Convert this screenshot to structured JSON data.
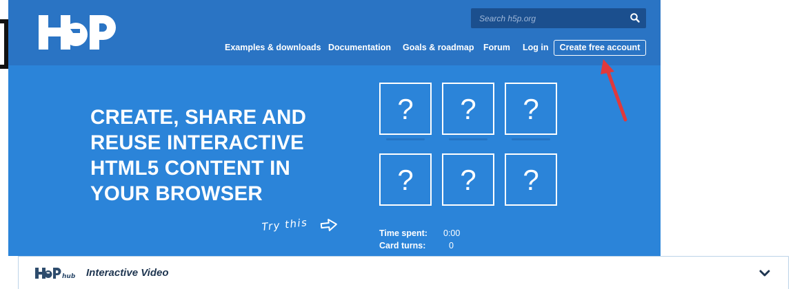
{
  "header": {
    "search_placeholder": "Search h5p.org",
    "nav": [
      "Examples & downloads",
      "Documentation",
      "Goals & roadmap",
      "Forum",
      "Log in"
    ],
    "cta_label": "Create free account"
  },
  "hero": {
    "headline_lines": [
      "CREATE, SHARE AND",
      "REUSE INTERACTIVE",
      "HTML5 CONTENT IN",
      "YOUR BROWSER"
    ],
    "try_label": "Try this",
    "cards": [
      "?",
      "?",
      "?",
      "?",
      "?",
      "?"
    ],
    "stats": {
      "time_label": "Time spent:",
      "time_value": "0:00",
      "turns_label": "Card turns:",
      "turns_value": "0"
    }
  },
  "panel": {
    "title": "Interactive Video"
  },
  "colors": {
    "header_bg": "#2a74c4",
    "hero_bg": "#2b84d9",
    "search_bg": "#1b4f8e",
    "annotation_arrow": "#e0393b"
  },
  "icons": [
    "h5p-logo",
    "search-icon",
    "arrow-right-icon",
    "annotation-arrow",
    "h5p-hub-logo",
    "chevron-down-icon"
  ]
}
